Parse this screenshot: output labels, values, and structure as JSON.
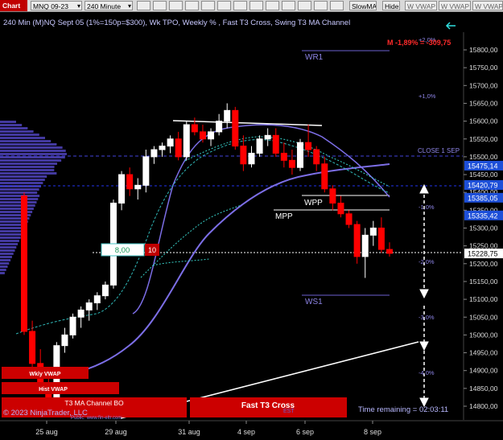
{
  "toolbar": {
    "chart_label": "Chart",
    "instrument": "MNQ 09-23",
    "interval": "240 Minute",
    "icon_buttons": [
      "crosshair-icon",
      "zoom-icon",
      "draw-icon",
      "properties-icon",
      "template-icon",
      "indicators-icon",
      "strategy-icon",
      "refresh-icon",
      "data-icon",
      "bars-icon",
      "plus-icon",
      "link-icon",
      "share-icon"
    ],
    "slowma": "SlowMA",
    "hide": "Hide",
    "w_vwap_1": "W VWAP",
    "w_vwap_2": "W VWAP",
    "w_vwap_3": "W VWAP"
  },
  "chart": {
    "title": "240 Min (M)NQ Sept 05 (1%=150p=$300), Wk TPO, Weekly % , Fast T3 Cross, Swing T3 MA Channel",
    "stats": "M -1,89% = -309,75",
    "copyright": "© 2023 NinjaTrader, LLC",
    "time_remaining": "Time remaining = 02:03:11",
    "colors": {
      "background": "#000000",
      "up": "#ffffff",
      "down": "#ff0000",
      "profile": "#5a4fc8",
      "accent": "#0000cc"
    }
  },
  "levels": {
    "wr1": "WR1",
    "ws1": "WS1",
    "wpp": "WPP",
    "mpp": "MPP",
    "close": "CLOSE 1 SEP",
    "pcts": [
      "+2,0%",
      "+1,0%",
      "-1,0%",
      "-2,0%",
      "-3,0%",
      "-4,0%"
    ]
  },
  "labels": {
    "wkly_vwap": "Wkly VWAP",
    "hist_vwap": "Hist VWAP",
    "t3_channel": "T3 MA Channel BO",
    "fast_t3": "Fast T3 Cross",
    "est": "EST",
    "box_value": "8,00",
    "box_count": "10",
    "watermark": "Public: www.fin-eltr.com"
  },
  "chart_data": {
    "type": "candlestick",
    "x_tick_labels": [
      "25 aug",
      "29 aug",
      "31 aug",
      "4 sep",
      "6 sep",
      "8 sep"
    ],
    "y_ticks": [
      14800,
      14850,
      14900,
      14950,
      15000,
      15050,
      15100,
      15150,
      15200,
      15250,
      15300,
      15350,
      15400,
      15450,
      15500,
      15550,
      15600,
      15650,
      15700,
      15750,
      15800
    ],
    "y_tick_labels": [
      "14800,00",
      "14850,00",
      "14900,00",
      "14950,00",
      "15000,00",
      "15050,00",
      "15100,00",
      "15150,00",
      "15200,00",
      "15250,00",
      "15300,00",
      "15350,00",
      "15400,00",
      "15450,00",
      "15500,00",
      "15550,00",
      "15600,00",
      "15650,00",
      "15700,00",
      "15750,00",
      "15800,00"
    ],
    "ylim": [
      14770,
      15830
    ],
    "price_tags": [
      {
        "label": "15475,14",
        "value": 15475.14,
        "color": "#1d4fd8"
      },
      {
        "label": "15420,79",
        "value": 15420.79,
        "color": "#1d4fd8"
      },
      {
        "label": "15385,05",
        "value": 15385.05,
        "color": "#1d4fd8"
      },
      {
        "label": "15335,42",
        "value": 15335.42,
        "color": "#1d4fd8"
      },
      {
        "label": "15228,75",
        "value": 15228.75,
        "color": "#ffffff"
      }
    ],
    "candles": [
      [
        15390,
        15400,
        15000,
        15010
      ],
      [
        15010,
        15040,
        14900,
        14920
      ],
      [
        14920,
        14960,
        14840,
        14850
      ],
      [
        14850,
        14880,
        14780,
        14800
      ],
      [
        14800,
        14980,
        14790,
        14970
      ],
      [
        14970,
        15020,
        14950,
        15000
      ],
      [
        15000,
        15060,
        14990,
        15050
      ],
      [
        15050,
        15080,
        15020,
        15070
      ],
      [
        15070,
        15100,
        15040,
        15090
      ],
      [
        15090,
        15120,
        15070,
        15110
      ],
      [
        15110,
        15150,
        15100,
        15140
      ],
      [
        15140,
        15380,
        15130,
        15370
      ],
      [
        15370,
        15460,
        15350,
        15450
      ],
      [
        15450,
        15470,
        15390,
        15410
      ],
      [
        15410,
        15440,
        15380,
        15420
      ],
      [
        15420,
        15520,
        15400,
        15500
      ],
      [
        15500,
        15530,
        15480,
        15520
      ],
      [
        15520,
        15540,
        15500,
        15530
      ],
      [
        15530,
        15560,
        15510,
        15550
      ],
      [
        15550,
        15570,
        15490,
        15500
      ],
      [
        15500,
        15600,
        15490,
        15590
      ],
      [
        15590,
        15610,
        15560,
        15570
      ],
      [
        15570,
        15590,
        15540,
        15550
      ],
      [
        15550,
        15580,
        15530,
        15570
      ],
      [
        15570,
        15620,
        15560,
        15600
      ],
      [
        15600,
        15650,
        15580,
        15630
      ],
      [
        15630,
        15640,
        15520,
        15530
      ],
      [
        15530,
        15560,
        15460,
        15480
      ],
      [
        15480,
        15530,
        15470,
        15510
      ],
      [
        15510,
        15560,
        15500,
        15550
      ],
      [
        15550,
        15580,
        15530,
        15560
      ],
      [
        15560,
        15580,
        15500,
        15510
      ],
      [
        15510,
        15540,
        15470,
        15490
      ],
      [
        15490,
        15520,
        15450,
        15470
      ],
      [
        15470,
        15550,
        15460,
        15540
      ],
      [
        15540,
        15590,
        15500,
        15520
      ],
      [
        15520,
        15530,
        15460,
        15480
      ],
      [
        15480,
        15500,
        15400,
        15410
      ],
      [
        15410,
        15420,
        15350,
        15370
      ],
      [
        15370,
        15390,
        15330,
        15340
      ],
      [
        15340,
        15350,
        15300,
        15310
      ],
      [
        15310,
        15320,
        15200,
        15220
      ],
      [
        15220,
        15300,
        15160,
        15280
      ],
      [
        15280,
        15320,
        15250,
        15300
      ],
      [
        15300,
        15330,
        15230,
        15240
      ],
      [
        15240,
        15260,
        15220,
        15229
      ]
    ]
  }
}
